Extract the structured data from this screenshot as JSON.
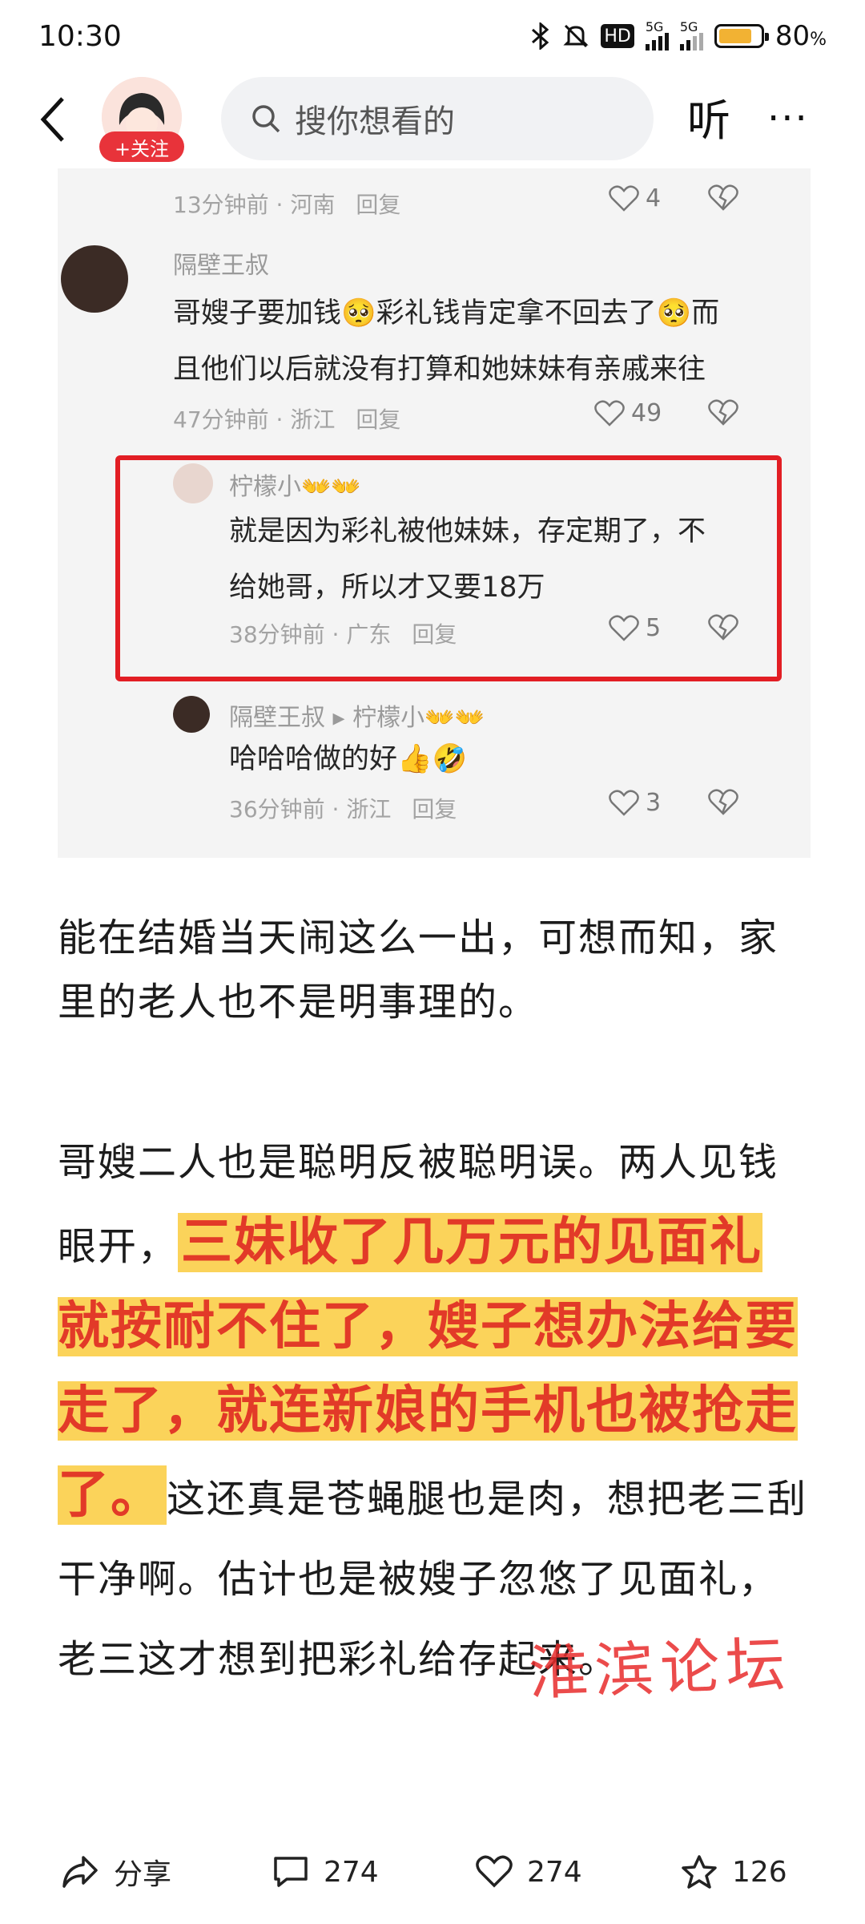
{
  "status_bar": {
    "time": "10:30",
    "network_1": "5G",
    "network_2": "5G",
    "hd_label": "HD",
    "battery": "80",
    "battery_unit": "%",
    "battery_level": 0.8
  },
  "nav": {
    "follow_label": "+关注",
    "search_placeholder": "搜你想看的",
    "listen_label": "听"
  },
  "comments": [
    {
      "meta_time": "13分钟前",
      "meta_region": "河南",
      "reply": "回复",
      "likes": "4"
    },
    {
      "name": "隔壁王叔",
      "text_line1": "哥嫂子要加钱🥺彩礼钱肯定拿不回去了🥺而",
      "text_line2": "且他们以后就没有打算和她妹妹有亲戚来往",
      "meta_time": "47分钟前",
      "meta_region": "浙江",
      "reply": "回复",
      "likes": "49"
    },
    {
      "name": "柠檬小👐👐",
      "text_line1": "就是因为彩礼被他妹妹，存定期了，不",
      "text_line2": "给她哥，所以才又要18万",
      "meta_time": "38分钟前",
      "meta_region": "广东",
      "reply": "回复",
      "likes": "5"
    },
    {
      "name": "隔壁王叔",
      "reply_to": "柠檬小👐👐",
      "text_line1": "哈哈哈做的好👍🤣",
      "meta_time": "36分钟前",
      "meta_region": "浙江",
      "reply": "回复",
      "likes": "3"
    }
  ],
  "article": {
    "p1": "能在结婚当天闹这么一出，可想而知，家里的老人也不是明事理的。",
    "p2_start": "哥嫂二人也是聪明反被聪明误。两人见钱眼开，",
    "p2_highlight": "三妹收了几万元的见面礼就按耐不住了，嫂子想办法给要走了，就连新娘的手机也被抢走了。",
    "p2_end": "这还真是苍蝇腿也是肉，想把老三刮干净啊。估计也是被嫂子忽悠了见面礼，老三这才想到把彩礼给存起来。"
  },
  "watermark": "淮滨论坛",
  "bottom_bar": {
    "share_label": "分享",
    "comment_count": "274",
    "like_count": "274",
    "favorite_count": "126"
  }
}
